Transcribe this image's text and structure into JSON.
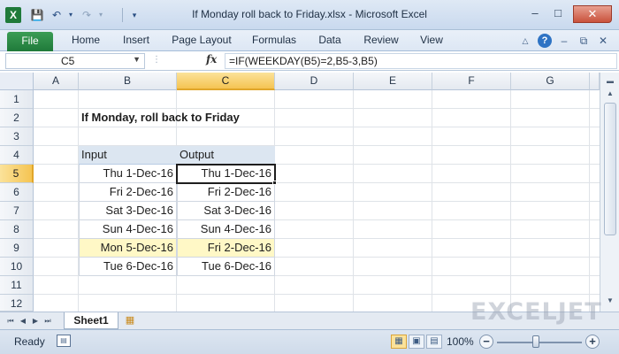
{
  "window": {
    "title": "If Monday roll back to Friday.xlsx - Microsoft Excel",
    "app_icon": "X"
  },
  "ribbon": {
    "tabs": [
      "File",
      "Home",
      "Insert",
      "Page Layout",
      "Formulas",
      "Data",
      "Review",
      "View"
    ]
  },
  "formula_bar": {
    "name_box": "C5",
    "fx": "fx",
    "formula": "=IF(WEEKDAY(B5)=2,B5-3,B5)"
  },
  "columns": [
    "A",
    "B",
    "C",
    "D",
    "E",
    "F",
    "G"
  ],
  "rows": [
    "1",
    "2",
    "3",
    "4",
    "5",
    "6",
    "7",
    "8",
    "9",
    "10",
    "11",
    "12"
  ],
  "sheet": {
    "title": "If Monday, roll back to Friday",
    "header_input": "Input",
    "header_output": "Output",
    "data": [
      {
        "input": "Thu 1-Dec-16",
        "output": "Thu 1-Dec-16"
      },
      {
        "input": "Fri 2-Dec-16",
        "output": "Fri 2-Dec-16"
      },
      {
        "input": "Sat 3-Dec-16",
        "output": "Sat 3-Dec-16"
      },
      {
        "input": "Sun 4-Dec-16",
        "output": "Sun 4-Dec-16"
      },
      {
        "input": "Mon 5-Dec-16",
        "output": "Fri 2-Dec-16"
      },
      {
        "input": "Tue 6-Dec-16",
        "output": "Tue 6-Dec-16"
      }
    ],
    "highlight_color": "#fff8c6",
    "header_fill": "#dce6f1"
  },
  "sheet_tabs": {
    "active": "Sheet1"
  },
  "watermark": "EXCELJET",
  "status": {
    "ready": "Ready",
    "zoom": "100%"
  },
  "colors": {
    "file_tab": "#1f7a3a",
    "selection_header": "#f5c452"
  }
}
